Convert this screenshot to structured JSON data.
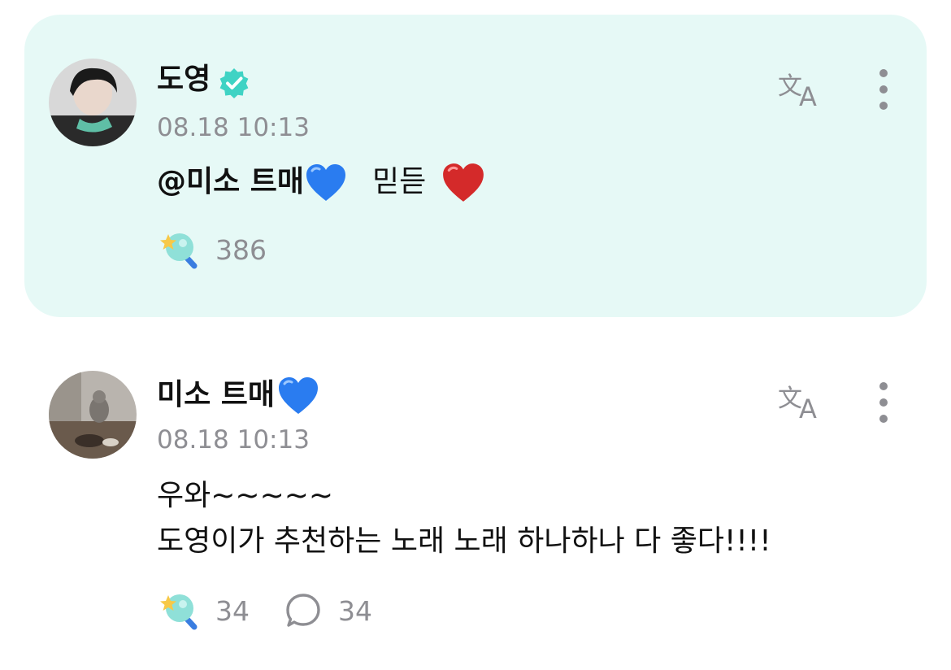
{
  "colors": {
    "card_bg": "#e6f9f6",
    "verified": "#3fd3c4",
    "text": "#111111",
    "muted": "#8e8e93",
    "blue_heart": "#2a7cf0",
    "red_heart": "#d42a2a"
  },
  "comments": [
    {
      "author": "도영",
      "verified_icon": "verified-badge-icon",
      "time": "08.18 10:13",
      "mention": "@미소 트매",
      "text": "믿듣",
      "heart_icons": [
        "blue-heart",
        "red-heart"
      ],
      "reaction_count": "386",
      "highlighted": true
    },
    {
      "author": "미소 트매",
      "author_heart_icon": "blue-heart",
      "time": "08.18 10:13",
      "text_line1": "우와~~~~~",
      "text_line2": "도영이가 추천하는 노래 노래 하나하나 다 좋다!!!!",
      "reaction_count": "34",
      "comment_count": "34",
      "highlighted": false
    }
  ],
  "icons": {
    "translate": "translate-icon",
    "more": "more-vertical-icon",
    "reaction": "star-lollipop-reaction-icon",
    "comment": "comment-bubble-icon"
  }
}
